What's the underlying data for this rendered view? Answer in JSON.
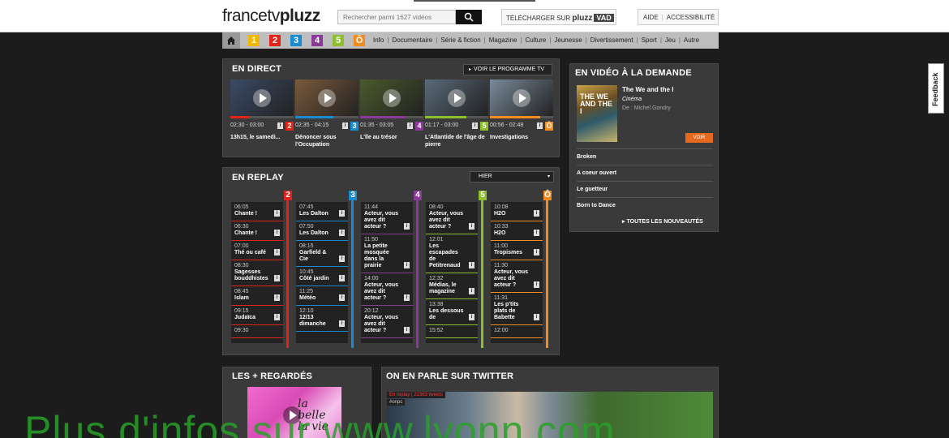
{
  "header": {
    "logo_part1": "francetv",
    "logo_part2": "pluzz",
    "search_placeholder": "Rechercher parmi 1627 vidéos",
    "download_label": "TÉLÉCHARGER SUR",
    "download_brand": "pluzz",
    "download_vad": "VAD",
    "aide": "AIDE",
    "accessibilite": "ACCESSIBILITÉ"
  },
  "nav": {
    "channels": [
      {
        "label": "1",
        "color": "#f2b705"
      },
      {
        "label": "2",
        "color": "#e2231a"
      },
      {
        "label": "3",
        "color": "#1a8bd1"
      },
      {
        "label": "4",
        "color": "#8c3a9a"
      },
      {
        "label": "5",
        "color": "#8dbf2f"
      },
      {
        "label": "Ô",
        "color": "#f28c1e"
      }
    ],
    "links": [
      "Info",
      "Documentaire",
      "Série & fiction",
      "Magazine",
      "Culture",
      "Jeunesse",
      "Divertissement",
      "Sport",
      "Jeu",
      "Autre"
    ]
  },
  "direct": {
    "title": "EN DIRECT",
    "voir_programme": "VOIR LE PROGRAMME TV",
    "items": [
      {
        "time": "02:30 - 03:00",
        "channel": "2",
        "color": "#e2231a",
        "title": "13h15, le samedi...",
        "progress": 0.3,
        "thumb": "#3b4a66"
      },
      {
        "time": "02:35 - 04:15",
        "channel": "3",
        "color": "#1a8bd1",
        "title": "Dénoncer sous l'Occupation",
        "progress": 0.6,
        "thumb": "#7a5a3c"
      },
      {
        "time": "01:35 - 03:05",
        "channel": "4",
        "color": "#8c3a9a",
        "title": "L'île au trésor",
        "progress": 0.7,
        "thumb": "#4a5a2c"
      },
      {
        "time": "01:17 - 03:00",
        "channel": "5",
        "color": "#8dbf2f",
        "title": "L'Atlantide de l'âge de pierre",
        "progress": 0.65,
        "thumb": "#5a6a7a"
      },
      {
        "time": "00:56 - 02:48",
        "channel": "Ô",
        "color": "#f28c1e",
        "title": "Investigations",
        "progress": 0.8,
        "thumb": "#7a8a9a"
      }
    ]
  },
  "replay": {
    "title": "EN REPLAY",
    "day": "HIER",
    "columns": [
      {
        "channel": "2",
        "color": "#e2231a",
        "entries": [
          {
            "time": "06:05",
            "name": "Chante !"
          },
          {
            "time": "06:30",
            "name": "Chante !"
          },
          {
            "time": "07:00",
            "name": "Thé ou café"
          },
          {
            "time": "08:30",
            "name": "Sagesses bouddhistes"
          },
          {
            "time": "08:45",
            "name": "Islam"
          },
          {
            "time": "09:15",
            "name": "Judaïca"
          },
          {
            "time": "09:30",
            "name": ""
          }
        ]
      },
      {
        "channel": "3",
        "color": "#1a8bd1",
        "entries": [
          {
            "time": "07:45",
            "name": "Les Dalton"
          },
          {
            "time": "07:50",
            "name": "Les Dalton"
          },
          {
            "time": "08:15",
            "name": "Garfield & Cie"
          },
          {
            "time": "10:45",
            "name": "Côté jardin"
          },
          {
            "time": "11:25",
            "name": "Météo"
          },
          {
            "time": "12:10",
            "name": "12/13 dimanche"
          }
        ]
      },
      {
        "channel": "4",
        "color": "#8c3a9a",
        "entries": [
          {
            "time": "11:44",
            "name": "Acteur, vous avez dit acteur ?"
          },
          {
            "time": "11:50",
            "name": "La petite mosquée dans la prairie"
          },
          {
            "time": "14:00",
            "name": "Acteur, vous avez dit acteur ?"
          },
          {
            "time": "20:12",
            "name": "Acteur, vous avez dit acteur ?"
          }
        ]
      },
      {
        "channel": "5",
        "color": "#8dbf2f",
        "entries": [
          {
            "time": "08:40",
            "name": "Acteur, vous avez dit acteur ?"
          },
          {
            "time": "12:01",
            "name": "Les escapades de Petitrenaud"
          },
          {
            "time": "12:32",
            "name": "Médias, le magazine"
          },
          {
            "time": "13:38",
            "name": "Les dessous de"
          },
          {
            "time": "15:52",
            "name": ""
          }
        ]
      },
      {
        "channel": "Ô",
        "color": "#f28c1e",
        "entries": [
          {
            "time": "10:08",
            "name": "H2O"
          },
          {
            "time": "10:33",
            "name": "H2O"
          },
          {
            "time": "11:00",
            "name": "Tropismes"
          },
          {
            "time": "11:30",
            "name": "Acteur, vous avez dit acteur ?"
          },
          {
            "time": "11:31",
            "name": "Les p'tits plats de Babette"
          },
          {
            "time": "12:00",
            "name": ""
          }
        ]
      }
    ]
  },
  "vod": {
    "title": "EN VIDÉO À LA DEMANDE",
    "poster_text": "THE WE AND THE I",
    "featured_title": "The We and the I",
    "featured_genre": "Cinéma",
    "featured_director": "De : Michel Gondry",
    "voir": "VOIR",
    "items": [
      "Broken",
      "A coeur ouvert",
      "Le guetteur",
      "Born to Dance"
    ],
    "all_new": "TOUTES LES NOUVEAUTÉS"
  },
  "regardes": {
    "title": "LES + REGARDÉS",
    "poster_text": "la belle la vie"
  },
  "twitter": {
    "title": "ON EN PARLE SUR TWITTER",
    "badge": "En replay | 22363 tweets",
    "tag": "#onpc"
  },
  "feedback": "Feedback",
  "watermark": "Plus d'infos sur www.lyonn.com"
}
